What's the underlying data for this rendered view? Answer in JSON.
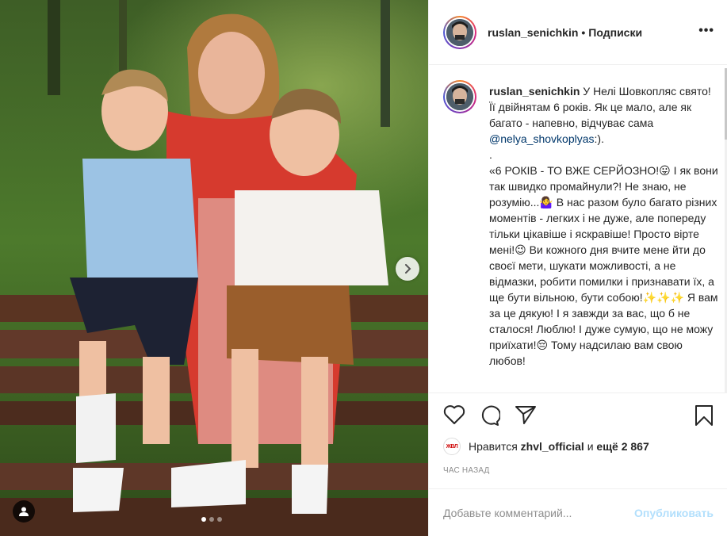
{
  "post": {
    "username": "ruslan_senichkin",
    "separator": "•",
    "follow_label": "Подписки",
    "more_label": "•••"
  },
  "caption": {
    "username": "ruslan_senichkin",
    "text_1": "У Нелі Шовкопляс свято! Її двійнятам 6 років. Як це мало, але як багато - напевно, відчуває сама ",
    "mention": "@nelya_shovkoplyas",
    "text_2": ":).",
    "dot": ".",
    "text_3": "«6 РОКІВ - ТО ВЖЕ СЕРЙОЗНО!😛 І як вони так швидко промайнули?! Не знаю, не розумію...🤷‍♀️ В нас разом було багато різних моментів - легких і не дуже, але попереду тільки цікавіше і яскравіше! Просто вірте мені!😉 Ви кожного дня вчите мене йти до своєї мети, шукати можливості, а не відмазки, робити помилки і признавати їх, а ще бути вільною, бути собою!✨✨✨ Я вам за це дякую! І я завжди за вас, що б не сталося! Люблю! І дуже сумую, що не можу приїхати!😔 Тому",
    "text_cut": "надсилаю вам свою любов!"
  },
  "actions": {
    "like_icon": "heart-icon",
    "comment_icon": "comment-icon",
    "share_icon": "paper-plane-icon",
    "save_icon": "bookmark-icon"
  },
  "likes": {
    "logo_text": "ЖВЛ",
    "prefix": "Нравится ",
    "user": "zhvl_official",
    "middle": " и ",
    "count": "ещё 2 867"
  },
  "timeago": "ЧАС НАЗАД",
  "comment": {
    "placeholder": "Добавьте комментарий...",
    "publish_label": "Опубликовать"
  },
  "carousel": {
    "total": 3,
    "active": 1
  }
}
